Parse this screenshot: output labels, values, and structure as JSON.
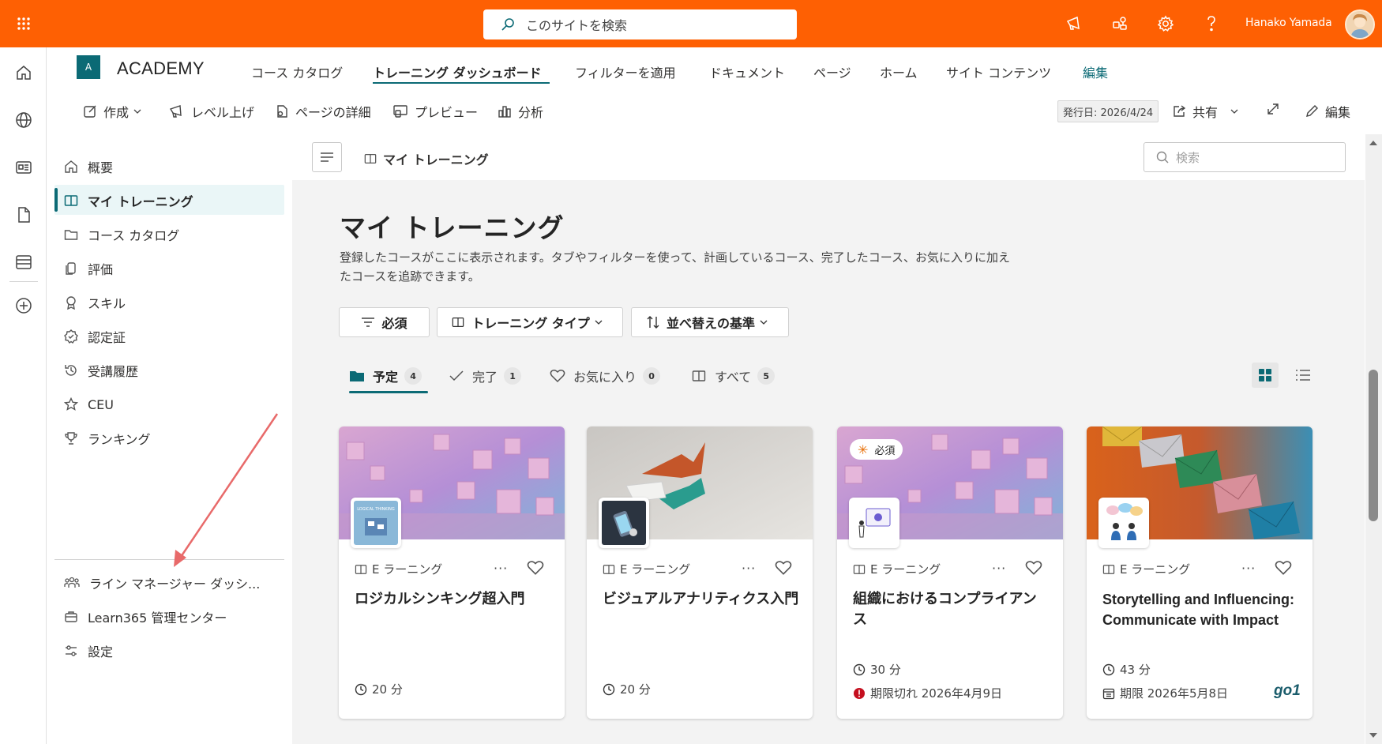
{
  "topbar": {
    "search_placeholder": "このサイトを検索",
    "user_name": "Hanako Yamada",
    "bg_color": "#fe6003"
  },
  "site": {
    "logo_letter": "A",
    "title": "ACADEMY",
    "nav": [
      {
        "label": "コース カタログ"
      },
      {
        "label": "トレーニング ダッシュボード"
      },
      {
        "label": "フィルターを適用"
      },
      {
        "label": "ドキュメント"
      },
      {
        "label": "ページ"
      },
      {
        "label": "ホーム"
      },
      {
        "label": "サイト コンテンツ"
      },
      {
        "label": "編集"
      }
    ]
  },
  "commandbar": {
    "create": "作成",
    "promote": "レベル上げ",
    "page_details": "ページの詳細",
    "preview": "プレビュー",
    "analytics": "分析",
    "published": "発行日: 2026/4/24",
    "share": "共有",
    "edit": "編集"
  },
  "leftnav": {
    "items": [
      {
        "label": "概要",
        "icon": "home-icon"
      },
      {
        "label": "マイ トレーニング",
        "icon": "book-icon"
      },
      {
        "label": "コース カタログ",
        "icon": "folder-icon"
      },
      {
        "label": "評価",
        "icon": "copy-icon"
      },
      {
        "label": "スキル",
        "icon": "ribbon-icon"
      },
      {
        "label": "認定証",
        "icon": "certificate-icon"
      },
      {
        "label": "受講履歴",
        "icon": "history-icon"
      },
      {
        "label": "CEU",
        "icon": "star-icon"
      },
      {
        "label": "ランキング",
        "icon": "trophy-icon"
      }
    ],
    "bottom_items": [
      {
        "label": "ライン マネージャー ダッシ...",
        "icon": "people-icon"
      },
      {
        "label": "Learn365 管理センター",
        "icon": "briefcase-icon"
      },
      {
        "label": "設定",
        "icon": "settings-sliders-icon"
      }
    ]
  },
  "main": {
    "breadcrumb": "マイ トレーニング",
    "search_placeholder": "検索",
    "title": "マイ トレーニング",
    "description": "登録したコースがここに表示されます。タブやフィルターを使って、計画しているコース、完了したコース、お気に入りに加えたコースを追跡できます。",
    "filters": [
      "必須",
      "トレーニング タイプ",
      "並べ替えの基準"
    ],
    "tabs": [
      {
        "label": "予定",
        "count": "4"
      },
      {
        "label": "完了",
        "count": "1"
      },
      {
        "label": "お気に入り",
        "count": "0"
      },
      {
        "label": "すべて",
        "count": "5"
      }
    ],
    "cards": [
      {
        "type": "E ラーニング",
        "more": "···",
        "title": "ロジカルシンキング超入門",
        "duration": "20 分",
        "required": "",
        "due": "",
        "thumb_text": "LOGICAL THINKING",
        "brand": ""
      },
      {
        "type": "E ラーニング",
        "more": "···",
        "title": "ビジュアルアナリティクス入門",
        "duration": "20 分",
        "required": "",
        "due": "",
        "thumb_text": "",
        "brand": ""
      },
      {
        "type": "E ラーニング",
        "more": "···",
        "title": "組織におけるコンプライアンス",
        "duration": "30 分",
        "required": "必須",
        "due": "期限切れ 2026年4月9日",
        "thumb_text": "",
        "brand": ""
      },
      {
        "type": "E ラーニング",
        "more": "···",
        "title": "Storytelling and Influencing: Communicate with Impact",
        "duration": "43 分",
        "required": "",
        "due": "期限 2026年5月8日",
        "thumb_text": "",
        "brand": "go1"
      }
    ]
  },
  "colors": {
    "accent": "#0b6a75",
    "overdue": "#c50f1f",
    "required_star": "#e8710a"
  }
}
